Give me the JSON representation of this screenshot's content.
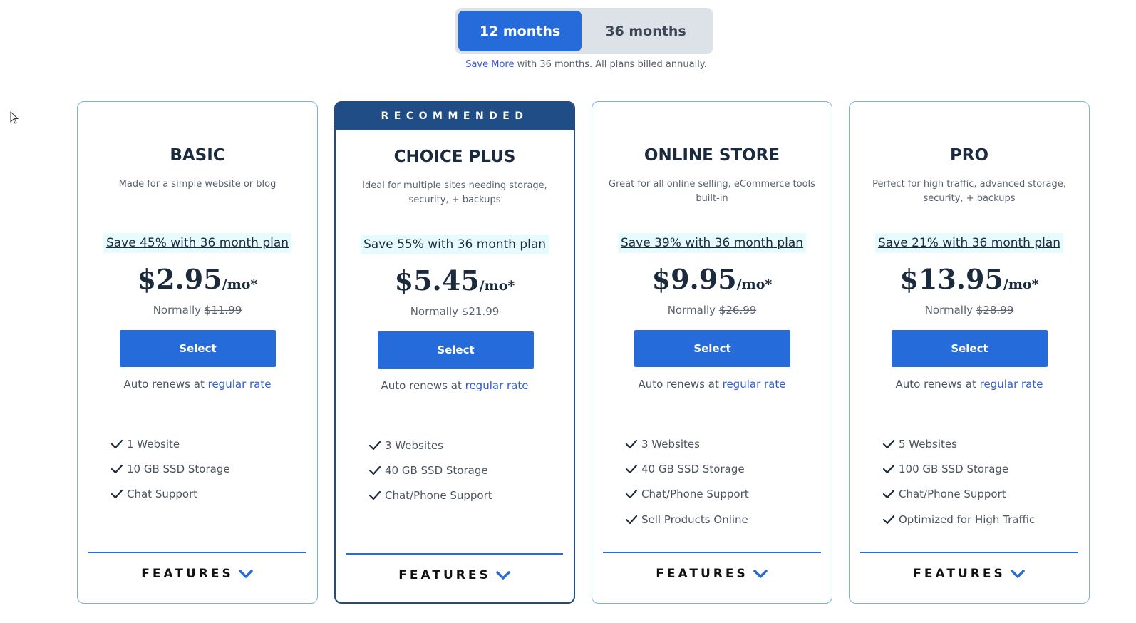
{
  "term_toggle": {
    "options": [
      {
        "label": "12 months",
        "selected": true
      },
      {
        "label": "36 months",
        "selected": false
      }
    ]
  },
  "billing_note": {
    "link_text": "Save More",
    "text": " with 36 months. All plans billed annually."
  },
  "colors": {
    "accent": "#256bd9",
    "recommended_banner": "#214d86",
    "card_border": "#7ab0ea",
    "save_highlight": "#e6fbfd"
  },
  "plans": [
    {
      "name": "BASIC",
      "description": "Made for a simple website or blog",
      "save_text": "Save 45% with 36 month plan",
      "price": "$2.95",
      "price_suffix": "/mo*",
      "normally_label": "Normally ",
      "normal_price": "$11.99",
      "select_label": "Select",
      "renew_text": "Auto renews at ",
      "renew_link": "regular rate",
      "features": [
        "1 Website",
        "10 GB SSD Storage",
        "Chat Support"
      ],
      "features_toggle": "FEATURES",
      "recommended": false
    },
    {
      "name": "CHOICE PLUS",
      "badge": "RECOMMENDED",
      "description": "Ideal for multiple sites needing storage, security, + backups",
      "save_text": "Save 55% with 36 month plan",
      "price": "$5.45",
      "price_suffix": "/mo*",
      "normally_label": "Normally ",
      "normal_price": "$21.99",
      "select_label": "Select",
      "renew_text": "Auto renews at ",
      "renew_link": "regular rate",
      "features": [
        "3 Websites",
        "40 GB SSD Storage",
        "Chat/Phone Support"
      ],
      "features_toggle": "FEATURES",
      "recommended": true
    },
    {
      "name": "ONLINE STORE",
      "description": "Great for all online selling, eCommerce tools built-in",
      "save_text": "Save 39% with 36 month plan",
      "price": "$9.95",
      "price_suffix": "/mo*",
      "normally_label": "Normally ",
      "normal_price": "$26.99",
      "select_label": "Select",
      "renew_text": "Auto renews at ",
      "renew_link": "regular rate",
      "features": [
        "3 Websites",
        "40 GB SSD Storage",
        "Chat/Phone Support",
        "Sell Products Online"
      ],
      "features_toggle": "FEATURES",
      "recommended": false
    },
    {
      "name": "PRO",
      "description": "Perfect for high traffic, advanced storage, security, + backups",
      "save_text": "Save 21% with 36 month plan",
      "price": "$13.95",
      "price_suffix": "/mo*",
      "normally_label": "Normally ",
      "normal_price": "$28.99",
      "select_label": "Select",
      "renew_text": "Auto renews at ",
      "renew_link": "regular rate",
      "features": [
        "5 Websites",
        "100 GB SSD Storage",
        "Chat/Phone Support",
        "Optimized for High Traffic"
      ],
      "features_toggle": "FEATURES",
      "recommended": false
    }
  ]
}
